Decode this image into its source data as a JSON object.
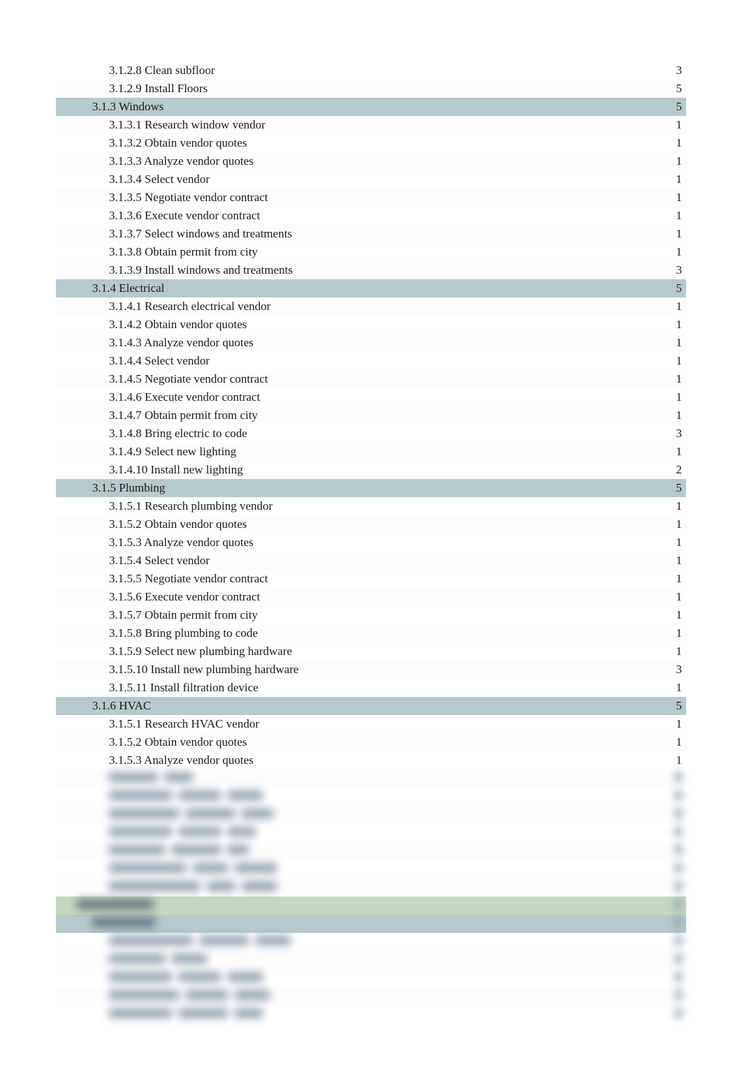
{
  "rows": [
    {
      "label": "3.1.2.8 Clean subfloor",
      "value": "3",
      "level": 3,
      "style": "leaf"
    },
    {
      "label": "3.1.2.9 Install Floors",
      "value": "5",
      "level": 3,
      "style": "leaf"
    },
    {
      "label": "3.1.3 Windows",
      "value": "5",
      "level": 2,
      "style": "heading"
    },
    {
      "label": "3.1.3.1 Research window vendor",
      "value": "1",
      "level": 3,
      "style": "leaf"
    },
    {
      "label": "3.1.3.2 Obtain vendor quotes",
      "value": "1",
      "level": 3,
      "style": "leaf"
    },
    {
      "label": "3.1.3.3 Analyze vendor quotes",
      "value": "1",
      "level": 3,
      "style": "leaf"
    },
    {
      "label": "3.1.3.4 Select vendor",
      "value": "1",
      "level": 3,
      "style": "leaf"
    },
    {
      "label": "3.1.3.5 Negotiate vendor contract",
      "value": "1",
      "level": 3,
      "style": "leaf"
    },
    {
      "label": "3.1.3.6 Execute vendor contract",
      "value": "1",
      "level": 3,
      "style": "leaf"
    },
    {
      "label": "3.1.3.7 Select windows and treatments",
      "value": "1",
      "level": 3,
      "style": "leaf"
    },
    {
      "label": "3.1.3.8 Obtain permit from city",
      "value": "1",
      "level": 3,
      "style": "leaf"
    },
    {
      "label": "3.1.3.9 Install windows and treatments",
      "value": "3",
      "level": 3,
      "style": "leaf"
    },
    {
      "label": "3.1.4 Electrical",
      "value": "5",
      "level": 2,
      "style": "heading"
    },
    {
      "label": "3.1.4.1 Research electrical vendor",
      "value": "1",
      "level": 3,
      "style": "leaf"
    },
    {
      "label": "3.1.4.2 Obtain vendor quotes",
      "value": "1",
      "level": 3,
      "style": "leaf"
    },
    {
      "label": "3.1.4.3 Analyze vendor quotes",
      "value": "1",
      "level": 3,
      "style": "leaf"
    },
    {
      "label": "3.1.4.4 Select vendor",
      "value": "1",
      "level": 3,
      "style": "leaf"
    },
    {
      "label": "3.1.4.5 Negotiate vendor contract",
      "value": "1",
      "level": 3,
      "style": "leaf"
    },
    {
      "label": "3.1.4.6 Execute vendor contract",
      "value": "1",
      "level": 3,
      "style": "leaf"
    },
    {
      "label": "3.1.4.7 Obtain permit from city",
      "value": "1",
      "level": 3,
      "style": "leaf"
    },
    {
      "label": "3.1.4.8 Bring electric to code",
      "value": "3",
      "level": 3,
      "style": "leaf"
    },
    {
      "label": "3.1.4.9 Select new lighting",
      "value": "1",
      "level": 3,
      "style": "leaf"
    },
    {
      "label": "3.1.4.10 Install new lighting",
      "value": "2",
      "level": 3,
      "style": "leaf"
    },
    {
      "label": "3.1.5 Plumbing",
      "value": "5",
      "level": 2,
      "style": "heading"
    },
    {
      "label": "3.1.5.1 Research plumbing vendor",
      "value": "1",
      "level": 3,
      "style": "leaf"
    },
    {
      "label": "3.1.5.2 Obtain vendor quotes",
      "value": "1",
      "level": 3,
      "style": "leaf"
    },
    {
      "label": "3.1.5.3 Analyze vendor quotes",
      "value": "1",
      "level": 3,
      "style": "leaf"
    },
    {
      "label": "3.1.5.4 Select vendor",
      "value": "1",
      "level": 3,
      "style": "leaf"
    },
    {
      "label": "3.1.5.5 Negotiate vendor contract",
      "value": "1",
      "level": 3,
      "style": "leaf"
    },
    {
      "label": "3.1.5.6 Execute vendor contract",
      "value": "1",
      "level": 3,
      "style": "leaf"
    },
    {
      "label": "3.1.5.7 Obtain permit from city",
      "value": "1",
      "level": 3,
      "style": "leaf"
    },
    {
      "label": "3.1.5.8 Bring plumbing to code",
      "value": "1",
      "level": 3,
      "style": "leaf"
    },
    {
      "label": "3.1.5.9 Select new plumbing hardware",
      "value": "1",
      "level": 3,
      "style": "leaf"
    },
    {
      "label": "3.1.5.10 Install new plumbing hardware",
      "value": "3",
      "level": 3,
      "style": "leaf"
    },
    {
      "label": "3.1.5.11 Install filtration device",
      "value": "1",
      "level": 3,
      "style": "leaf"
    },
    {
      "label": "3.1.6 HVAC",
      "value": "5",
      "level": 2,
      "style": "heading"
    },
    {
      "label": "3.1.5.1 Research HVAC vendor",
      "value": "1",
      "level": 3,
      "style": "leaf"
    },
    {
      "label": "3.1.5.2 Obtain vendor quotes",
      "value": "1",
      "level": 3,
      "style": "leaf"
    },
    {
      "label": "3.1.5.3 Analyze vendor quotes",
      "value": "1",
      "level": 3,
      "style": "leaf"
    },
    {
      "blur": true,
      "level": 3,
      "style": "leaf",
      "blocks": [
        70,
        40
      ]
    },
    {
      "blur": true,
      "level": 3,
      "style": "leaf",
      "blocks": [
        90,
        60,
        50
      ]
    },
    {
      "blur": true,
      "level": 3,
      "style": "leaf",
      "blocks": [
        100,
        70,
        45
      ]
    },
    {
      "blur": true,
      "level": 3,
      "style": "leaf",
      "blocks": [
        90,
        60,
        40
      ]
    },
    {
      "blur": true,
      "level": 3,
      "style": "leaf",
      "blocks": [
        80,
        70,
        30
      ]
    },
    {
      "blur": true,
      "level": 3,
      "style": "leaf",
      "blocks": [
        110,
        50,
        60
      ]
    },
    {
      "blur": true,
      "level": 3,
      "style": "leaf",
      "blocks": [
        130,
        40,
        50
      ]
    },
    {
      "blur": true,
      "level": 1,
      "style": "greenish",
      "blocks": [
        110
      ]
    },
    {
      "blur": true,
      "level": 2,
      "style": "heading",
      "blocks": [
        90
      ]
    },
    {
      "blur": true,
      "level": 3,
      "style": "leaf",
      "blocks": [
        120,
        70,
        50
      ]
    },
    {
      "blur": true,
      "level": 3,
      "style": "leaf",
      "blocks": [
        80,
        50
      ]
    },
    {
      "blur": true,
      "level": 3,
      "style": "leaf",
      "blocks": [
        90,
        60,
        50
      ]
    },
    {
      "blur": true,
      "level": 3,
      "style": "leaf",
      "blocks": [
        100,
        60,
        50
      ]
    },
    {
      "blur": true,
      "level": 3,
      "style": "leaf",
      "blocks": [
        90,
        70,
        40
      ]
    }
  ]
}
